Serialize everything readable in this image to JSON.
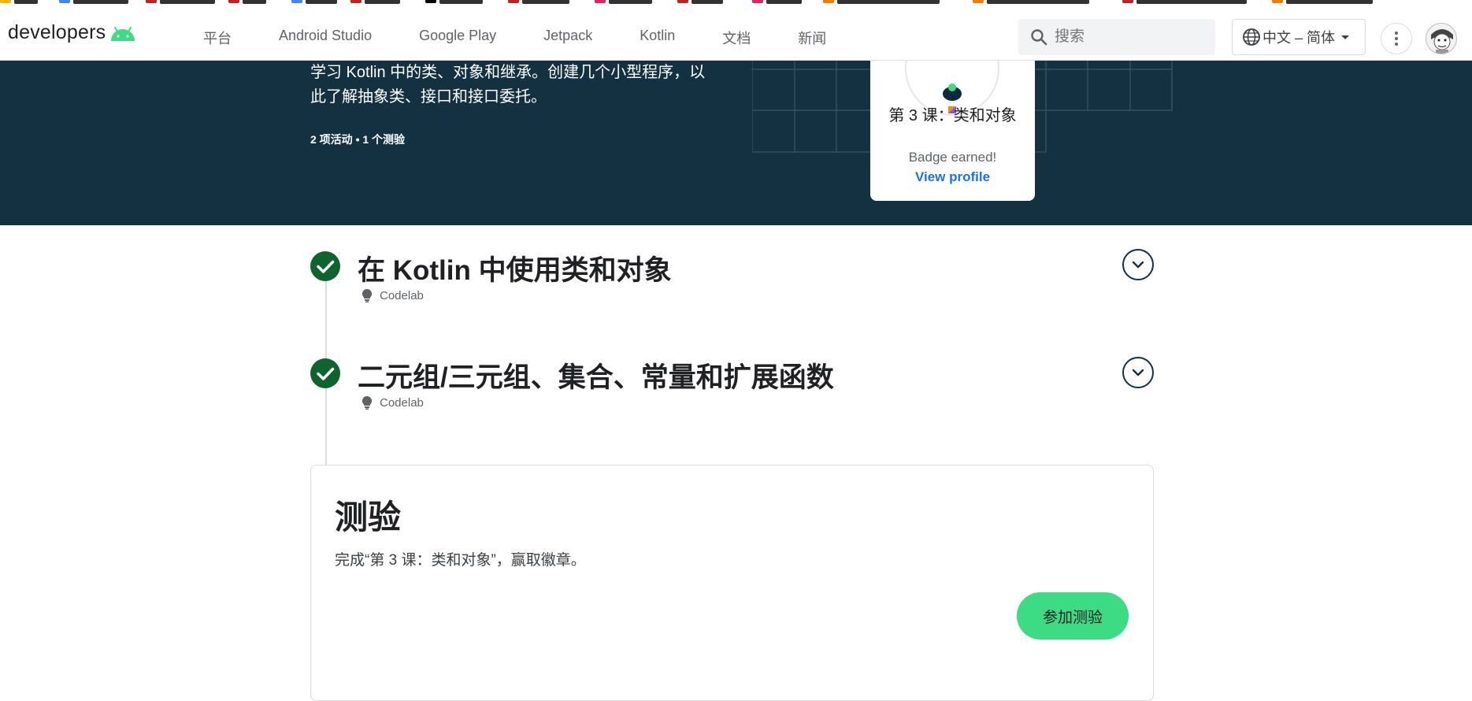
{
  "nav": {
    "brand": "developers",
    "links": [
      "平台",
      "Android Studio",
      "Google Play",
      "Jetpack",
      "Kotlin",
      "文档",
      "新闻"
    ],
    "search_placeholder": "搜索",
    "language": "中文 – 简体"
  },
  "hero": {
    "description": "学习 Kotlin 中的类、对象和继承。创建几个小型程序，以此了解抽象类、接口和接口委托。",
    "meta": "2 项活动 • 1 个测验"
  },
  "badge": {
    "title": "第 3 课：类和对象",
    "earned": "Badge earned!",
    "link": "View profile"
  },
  "steps": [
    {
      "title": "在 Kotlin 中使用类和对象",
      "type": "Codelab",
      "completed": true
    },
    {
      "title": "二元组/三元组、集合、常量和扩展函数",
      "type": "Codelab",
      "completed": true
    }
  ],
  "quiz": {
    "title": "测验",
    "description": "完成“第 3 课：类和对象”，赢取徽章。",
    "button": "参加测验"
  },
  "colors": {
    "hero_bg": "#143142",
    "check_green": "#0d652d",
    "button_green": "#3ddc84",
    "link_blue": "#1a73e8"
  }
}
